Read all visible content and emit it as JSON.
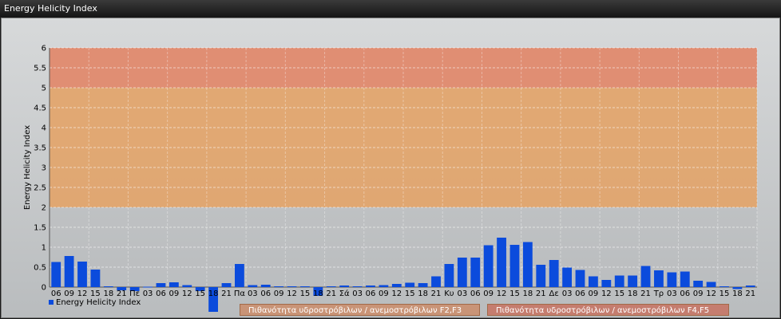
{
  "window": {
    "title": "Energy Helicity Index"
  },
  "chart_data": {
    "type": "bar",
    "title": "",
    "ylabel": "Energy Helicity Index",
    "xlabel": "",
    "ylim": [
      -0.6,
      6
    ],
    "yticks": [
      "0",
      "0.5",
      "1",
      "1.5",
      "2",
      "2.5",
      "3",
      "3.5",
      "4",
      "4.5",
      "5",
      "5.5",
      "6"
    ],
    "grid": true,
    "legend_position": "bottom-left",
    "bands": [
      {
        "from": 0,
        "to": 2,
        "color": "#b9bcbe"
      },
      {
        "from": 2,
        "to": 5,
        "color": "#e1a56e",
        "label": "Πιθανότητα υδροστρόβιλων / ανεμοστρόβιλων F2,F3"
      },
      {
        "from": 5,
        "to": 6,
        "color": "#e08a6e",
        "label": "Πιθανότητα υδροστρόβιλων / ανεμοστρόβιλων F4,F5"
      }
    ],
    "categories": [
      "06",
      "09",
      "12",
      "15",
      "18",
      "21",
      "Πε",
      "03",
      "06",
      "09",
      "12",
      "15",
      "18",
      "21",
      "Πα",
      "03",
      "06",
      "09",
      "12",
      "15",
      "18",
      "21",
      "Σά",
      "03",
      "06",
      "09",
      "12",
      "15",
      "18",
      "21",
      "Κυ",
      "03",
      "06",
      "09",
      "12",
      "15",
      "18",
      "21",
      "Δε",
      "03",
      "06",
      "09",
      "12",
      "15",
      "18",
      "21",
      "Τρ",
      "03",
      "06",
      "09",
      "12",
      "15",
      "18",
      "21"
    ],
    "series": [
      {
        "name": "Energy Helicity Index",
        "color": "#0b4bdc",
        "values": [
          0.63,
          0.78,
          0.64,
          0.44,
          0.02,
          -0.08,
          -0.1,
          0.01,
          0.1,
          0.12,
          0.05,
          -0.1,
          -0.62,
          0.1,
          0.58,
          0.05,
          0.06,
          0.02,
          0.02,
          0.02,
          -0.22,
          0.02,
          0.04,
          0.02,
          0.04,
          0.05,
          0.08,
          0.11,
          0.1,
          0.27,
          0.58,
          0.74,
          0.74,
          1.05,
          1.24,
          1.06,
          1.13,
          0.56,
          0.68,
          0.49,
          0.43,
          0.27,
          0.18,
          0.29,
          0.29,
          0.53,
          0.42,
          0.37,
          0.39,
          0.16,
          0.13,
          0.02,
          -0.05,
          0.04
        ]
      }
    ]
  }
}
